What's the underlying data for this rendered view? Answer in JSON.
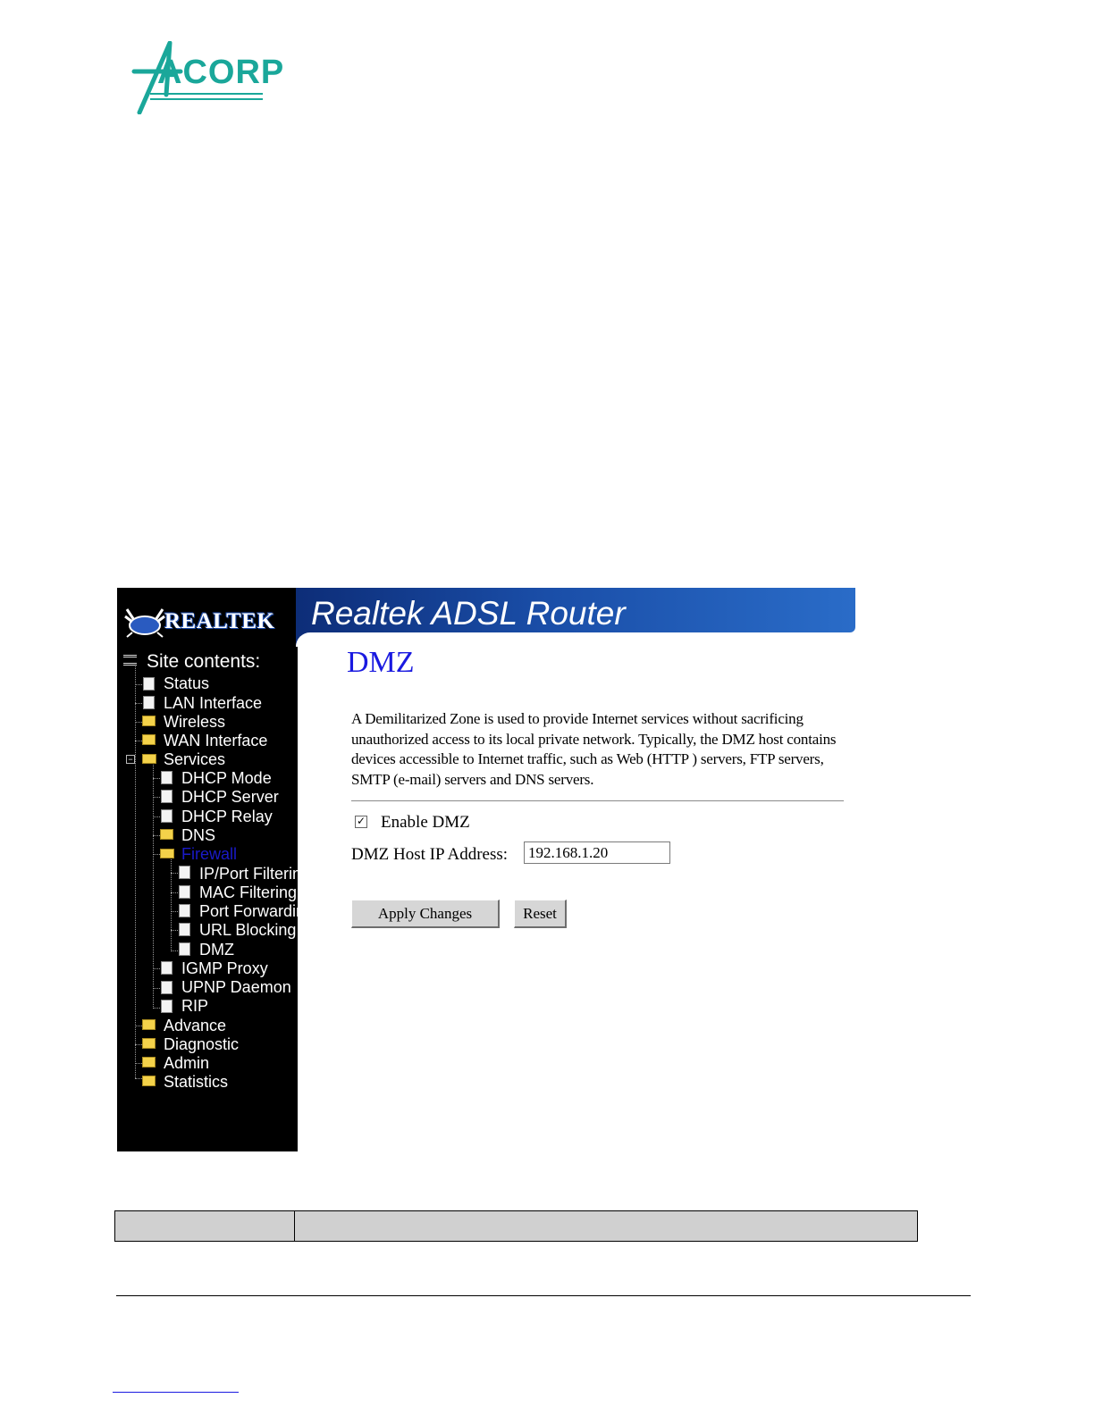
{
  "logo": {
    "brand": "ACORP"
  },
  "router": {
    "banner_logo": "REALTEK",
    "title": "Realtek ADSL Router",
    "sidebar": {
      "root": "Site contents:",
      "items": [
        "Status",
        "LAN Interface",
        "Wireless",
        "WAN Interface",
        "Services",
        "DHCP Mode",
        "DHCP Server",
        "DHCP Relay",
        "DNS",
        "Firewall",
        "IP/Port Filtering",
        "MAC Filtering",
        "Port Forwarding",
        "URL Blocking",
        "DMZ",
        "IGMP Proxy",
        "UPNP Daemon",
        "RIP",
        "Advance",
        "Diagnostic",
        "Admin",
        "Statistics"
      ]
    },
    "page": {
      "heading": "DMZ",
      "description": "A Demilitarized Zone is used to provide Internet services without sacrificing unauthorized access to its local private network. Typically, the DMZ host contains devices accessible to Internet traffic, such as Web (HTTP ) servers, FTP servers, SMTP (e-mail) servers and DNS servers.",
      "enable_label": "Enable DMZ",
      "enable_checked": true,
      "host_label": "DMZ Host IP Address:",
      "host_value": "192.168.1.20",
      "apply_label": "Apply Changes",
      "reset_label": "Reset"
    }
  },
  "colors": {
    "acorp_teal": "#1aa79a",
    "banner_blue": "#1a4ea8",
    "heading_blue": "#1a1ae0",
    "active_item": "#1a1ac8"
  }
}
